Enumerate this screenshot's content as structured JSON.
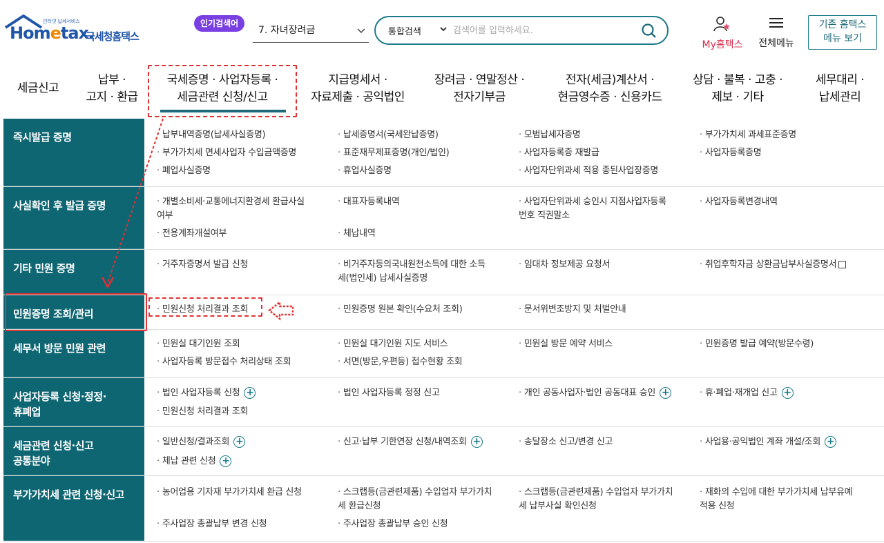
{
  "header": {
    "logo_small_text": "인터넷 납세서비스",
    "logo_brand_pre": "Hom",
    "logo_brand_e": "e",
    "logo_brand_post": "tax.",
    "logo_korean": "국세청홈택스",
    "popular_badge": "인기검색어",
    "popular_selected": "7.  자녀장려금",
    "search_scope": "통합검색",
    "search_placeholder": "검색어를 입력하세요.",
    "mytax_label": "My홈택스",
    "allmenu_label": "전체메뉴",
    "oldmenu_line1": "기존 홈택스",
    "oldmenu_line2": "메뉴 보기"
  },
  "nav": {
    "items": [
      "세금신고",
      "납부 ·\n고지 · 환급",
      "국세증명 · 사업자등록 ·\n세금관련 신청/신고",
      "지급명세서 ·\n자료제출 · 공익법인",
      "장려금 · 연말정산 ·\n전자기부금",
      "전자(세금)계산서 ·\n현금영수증 · 신용카드",
      "상담 · 불복 · 고충 ·\n제보 · 기타",
      "세무대리 ·\n납세관리"
    ]
  },
  "sections": [
    {
      "title": "즉시발급 증명",
      "cells": [
        [
          "납부내역증명(납세사실증명)",
          "부가가치세 면세사업자 수입금액증명",
          "폐업사실증명"
        ],
        [
          "납세증명서(국세완납증명)",
          "표준재무제표증명(개인/법인)",
          "휴업사실증명"
        ],
        [
          "모범납세자증명",
          "사업자등록증 재발급",
          "사업자단위과세 적용 종된사업장증명"
        ],
        [
          "부가가치세 과세표준증명",
          "사업자등록증명"
        ]
      ]
    },
    {
      "title": "사실확인 후 발급 증명",
      "cells": [
        [
          "개별소비세·교통에너지환경세 환급사실\n여부",
          "전용계좌개설여부"
        ],
        [
          "대표자등록내역",
          "체납내역"
        ],
        [
          "사업자단위과세 승인시 지점사업자등록\n번호 직권말소"
        ],
        [
          "사업자등록변경내역"
        ]
      ]
    },
    {
      "title": "기타 민원 증명",
      "cells": [
        [
          "거주자증명서 발급 신청"
        ],
        [
          "비거주자등의국내원천소득에 대한 소득\n세(법인세) 납세사실증명"
        ],
        [
          "임대차 정보제공 요청서"
        ],
        [
          "취업후학자금 상환금납부사실증명서"
        ]
      ]
    },
    {
      "title": "민원증명 조회/관리",
      "cells": [
        [
          "민원신청 처리결과 조회"
        ],
        [
          "민원증명 원본 확인(수요처 조회)"
        ],
        [
          "문서위변조방지 및 처벌안내"
        ],
        []
      ]
    },
    {
      "title": "세무서 방문 민원 관련",
      "cells": [
        [
          "민원실 대기인원 조회",
          "사업자등록 방문접수 처리상태 조회"
        ],
        [
          "민원실 대기인원 지도 서비스",
          "서면(방문,우편등) 접수현황 조회"
        ],
        [
          "민원실 방문 예약 서비스"
        ],
        [
          "민원증명 발급 예약(방문수령)"
        ]
      ]
    },
    {
      "title": "사업자등록 신청·정정·\n휴폐업",
      "cells": [
        [
          "법인 사업자등록 신청",
          "민원신청 처리결과 조회"
        ],
        [
          "법인 사업자등록 정정 신고"
        ],
        [
          "개인 공동사업자·법인 공동대표 승인"
        ],
        [
          "휴·폐업·재개업 신고"
        ]
      ]
    },
    {
      "title": "세금관련 신청·신고\n공통분야",
      "cells": [
        [
          "일반신청/결과조회",
          "체납 관련 신청"
        ],
        [
          "신고·납부 기한연장 신청/내역조회"
        ],
        [
          "송달장소 신고/변경 신고"
        ],
        [
          "사업용·공익법인 계좌 개설/조회"
        ]
      ]
    },
    {
      "title": "부가가치세 관련 신청·신고",
      "cells": [
        [
          "농어업용 기자재 부가가치세 환급 신청",
          "주사업장 총괄납부 변경 신청"
        ],
        [
          "스크랩등(금관련제품) 수입업자 부가가치\n세 환급신청",
          "주사업장 총괄납부 승인 신청"
        ],
        [
          "스크랩등(금관련제품) 수입업자 부가가치\n세 납부사실 확인신청"
        ],
        [
          "재화의 수입에 대한 부가가치세 납부유예\n적용 신청"
        ]
      ]
    }
  ],
  "plus_symbol": "+",
  "bullet": "·"
}
